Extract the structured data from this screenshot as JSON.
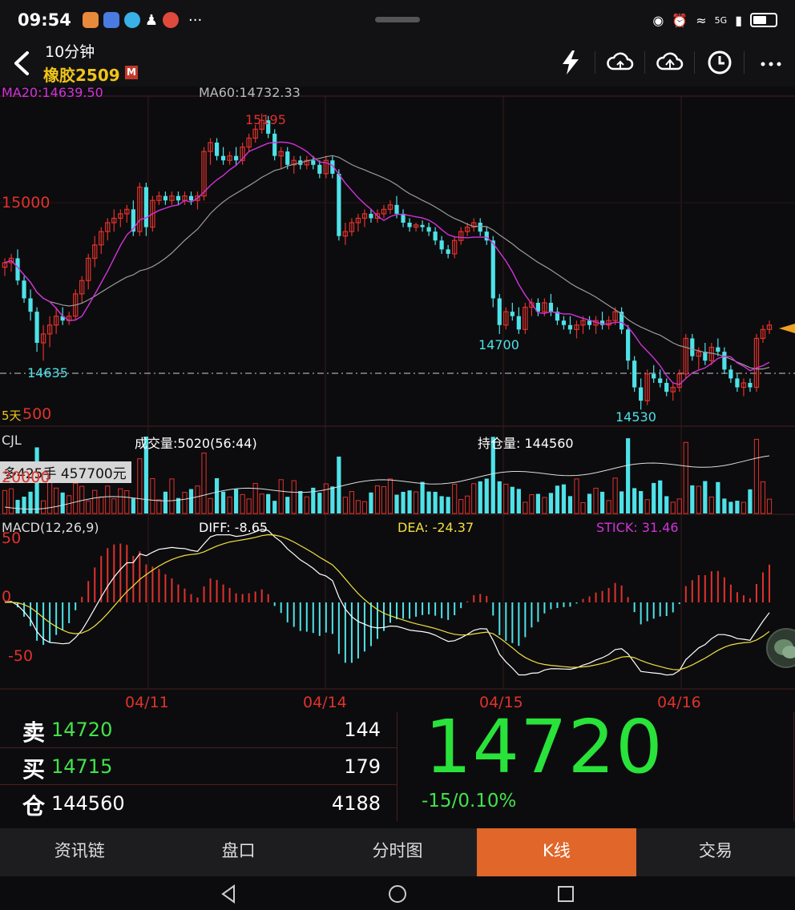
{
  "status_bar": {
    "time": "09:54",
    "network": "5G"
  },
  "header": {
    "period": "10分钟",
    "instrument": "橡胶2509",
    "badge": "M"
  },
  "indicators": {
    "ma20": "MA20:14639.50",
    "ma60": "MA60:14732.33",
    "price_high_label": "15195",
    "price_15000_label": "15000",
    "label_14700": "14700",
    "label_14635": "14635",
    "label_14530": "14530",
    "bottom_axis_label": "500",
    "period_overlay": "5天",
    "position_info": "多425手  457700元"
  },
  "volume_panel": {
    "name": "CJL",
    "volume": "成交量:5020(56:44)",
    "open_interest": "持仓量: 144560",
    "axis_label": "20000"
  },
  "macd_panel": {
    "name": "MACD(12,26,9)",
    "diff": "DIFF: -8.65",
    "dea": "DEA: -24.37",
    "stick": "STICK: 31.46",
    "axis_top": "50",
    "axis_zero": "0",
    "axis_bottom": "-50"
  },
  "date_labels": [
    "04/11",
    "04/14",
    "04/15",
    "04/16"
  ],
  "quote": {
    "sell_label": "卖",
    "sell_price": "14720",
    "sell_qty": "144",
    "buy_label": "买",
    "buy_price": "14715",
    "buy_qty": "179",
    "oi_label": "仓",
    "oi_value": "144560",
    "oi_change": "4188",
    "last_price": "14720",
    "change": "-15/0.10%"
  },
  "tabs": [
    "资讯链",
    "盘口",
    "分时图",
    "K线",
    "交易"
  ],
  "active_tab": "K线",
  "colors": {
    "up": "#e0322c",
    "down": "#4ee2e8",
    "ma20": "#d233d8",
    "ma60": "#9a9a9a",
    "price_green": "#29e23a",
    "accent_tab": "#e0662a",
    "title": "#f0c419"
  },
  "chart_data": {
    "type": "candlestick",
    "price_range": [
      14500,
      15220
    ],
    "candles": [
      [
        14850,
        14870,
        14830,
        14860
      ],
      [
        14860,
        14880,
        14840,
        14870
      ],
      [
        14870,
        14890,
        14810,
        14820
      ],
      [
        14820,
        14830,
        14770,
        14780
      ],
      [
        14780,
        14800,
        14730,
        14750
      ],
      [
        14750,
        14760,
        14660,
        14680
      ],
      [
        14680,
        14720,
        14640,
        14700
      ],
      [
        14700,
        14740,
        14670,
        14720
      ],
      [
        14720,
        14760,
        14700,
        14740
      ],
      [
        14740,
        14760,
        14720,
        14730
      ],
      [
        14730,
        14750,
        14720,
        14740
      ],
      [
        14740,
        14800,
        14730,
        14790
      ],
      [
        14790,
        14830,
        14770,
        14820
      ],
      [
        14820,
        14880,
        14800,
        14870
      ],
      [
        14870,
        14920,
        14850,
        14900
      ],
      [
        14900,
        14940,
        14880,
        14930
      ],
      [
        14930,
        14960,
        14910,
        14950
      ],
      [
        14950,
        14980,
        14930,
        14960
      ],
      [
        14960,
        14980,
        14940,
        14970
      ],
      [
        14970,
        14990,
        14950,
        14980
      ],
      [
        14980,
        15000,
        14920,
        14930
      ],
      [
        14930,
        15040,
        14920,
        15030
      ],
      [
        15030,
        15040,
        14920,
        14940
      ],
      [
        14940,
        15010,
        14930,
        15000
      ],
      [
        15000,
        15020,
        14990,
        15010
      ],
      [
        15010,
        15020,
        14990,
        15000
      ],
      [
        15000,
        15020,
        14990,
        15010
      ],
      [
        15010,
        15020,
        14990,
        15000
      ],
      [
        15000,
        15020,
        14990,
        15010
      ],
      [
        15010,
        15020,
        14990,
        15000
      ],
      [
        15000,
        15020,
        14980,
        15010
      ],
      [
        15010,
        15120,
        15000,
        15110
      ],
      [
        15110,
        15140,
        15080,
        15130
      ],
      [
        15130,
        15140,
        15090,
        15100
      ],
      [
        15100,
        15120,
        15080,
        15090
      ],
      [
        15090,
        15110,
        15080,
        15100
      ],
      [
        15100,
        15120,
        15080,
        15090
      ],
      [
        15090,
        15130,
        15080,
        15120
      ],
      [
        15120,
        15150,
        15110,
        15140
      ],
      [
        15140,
        15170,
        15130,
        15160
      ],
      [
        15160,
        15195,
        15150,
        15180
      ],
      [
        15180,
        15190,
        15140,
        15150
      ],
      [
        15150,
        15160,
        15090,
        15100
      ],
      [
        15100,
        15120,
        15070,
        15110
      ],
      [
        15110,
        15120,
        15070,
        15080
      ],
      [
        15080,
        15100,
        15060,
        15090
      ],
      [
        15090,
        15100,
        15070,
        15080
      ],
      [
        15080,
        15100,
        15070,
        15090
      ],
      [
        15090,
        15100,
        15070,
        15080
      ],
      [
        15080,
        15090,
        15050,
        15060
      ],
      [
        15060,
        15100,
        15050,
        15090
      ],
      [
        15090,
        15100,
        15050,
        15060
      ],
      [
        15060,
        15070,
        14910,
        14920
      ],
      [
        14920,
        14950,
        14900,
        14930
      ],
      [
        14930,
        14960,
        14920,
        14950
      ],
      [
        14950,
        14970,
        14930,
        14960
      ],
      [
        14960,
        14980,
        14940,
        14970
      ],
      [
        14970,
        14980,
        14950,
        14960
      ],
      [
        14960,
        14980,
        14950,
        14970
      ],
      [
        14970,
        14990,
        14960,
        14980
      ],
      [
        14980,
        15000,
        14970,
        14990
      ],
      [
        14990,
        15010,
        14960,
        14970
      ],
      [
        14970,
        14980,
        14940,
        14950
      ],
      [
        14950,
        14960,
        14930,
        14940
      ],
      [
        14940,
        14950,
        14930,
        14945
      ],
      [
        14945,
        14955,
        14930,
        14940
      ],
      [
        14940,
        14950,
        14920,
        14930
      ],
      [
        14930,
        14940,
        14900,
        14910
      ],
      [
        14910,
        14920,
        14880,
        14890
      ],
      [
        14890,
        14900,
        14870,
        14880
      ],
      [
        14880,
        14920,
        14870,
        14910
      ],
      [
        14910,
        14940,
        14900,
        14930
      ],
      [
        14930,
        14950,
        14920,
        14940
      ],
      [
        14940,
        14960,
        14930,
        14950
      ],
      [
        14950,
        14960,
        14920,
        14930
      ],
      [
        14930,
        14940,
        14900,
        14910
      ],
      [
        14910,
        14920,
        14760,
        14780
      ],
      [
        14780,
        14790,
        14700,
        14720
      ],
      [
        14720,
        14760,
        14710,
        14750
      ],
      [
        14750,
        14770,
        14730,
        14740
      ],
      [
        14740,
        14760,
        14700,
        14710
      ],
      [
        14710,
        14770,
        14700,
        14760
      ],
      [
        14760,
        14780,
        14740,
        14770
      ],
      [
        14770,
        14780,
        14740,
        14750
      ],
      [
        14750,
        14780,
        14740,
        14770
      ],
      [
        14770,
        14790,
        14740,
        14750
      ],
      [
        14750,
        14760,
        14720,
        14730
      ],
      [
        14730,
        14740,
        14710,
        14720
      ],
      [
        14720,
        14740,
        14700,
        14710
      ],
      [
        14710,
        14730,
        14690,
        14720
      ],
      [
        14720,
        14740,
        14700,
        14730
      ],
      [
        14730,
        14740,
        14710,
        14720
      ],
      [
        14720,
        14740,
        14700,
        14730
      ],
      [
        14730,
        14750,
        14710,
        14720
      ],
      [
        14720,
        14740,
        14710,
        14730
      ],
      [
        14730,
        14760,
        14720,
        14750
      ],
      [
        14750,
        14760,
        14700,
        14710
      ],
      [
        14710,
        14720,
        14620,
        14640
      ],
      [
        14640,
        14650,
        14570,
        14580
      ],
      [
        14580,
        14600,
        14530,
        14550
      ],
      [
        14550,
        14620,
        14540,
        14610
      ],
      [
        14610,
        14630,
        14590,
        14600
      ],
      [
        14600,
        14620,
        14580,
        14590
      ],
      [
        14590,
        14600,
        14560,
        14570
      ],
      [
        14570,
        14590,
        14550,
        14580
      ],
      [
        14580,
        14620,
        14570,
        14610
      ],
      [
        14610,
        14700,
        14600,
        14690
      ],
      [
        14690,
        14700,
        14640,
        14650
      ],
      [
        14650,
        14670,
        14620,
        14660
      ],
      [
        14660,
        14680,
        14630,
        14640
      ],
      [
        14640,
        14680,
        14630,
        14670
      ],
      [
        14670,
        14690,
        14650,
        14660
      ],
      [
        14660,
        14670,
        14610,
        14620
      ],
      [
        14620,
        14630,
        14590,
        14600
      ],
      [
        14600,
        14610,
        14570,
        14580
      ],
      [
        14580,
        14600,
        14560,
        14590
      ],
      [
        14590,
        14600,
        14570,
        14580
      ],
      [
        14580,
        14700,
        14570,
        14690
      ],
      [
        14690,
        14720,
        14680,
        14710
      ],
      [
        14710,
        14730,
        14700,
        14720
      ]
    ],
    "ma20_label": "MA20",
    "ma60_label": "MA60"
  }
}
